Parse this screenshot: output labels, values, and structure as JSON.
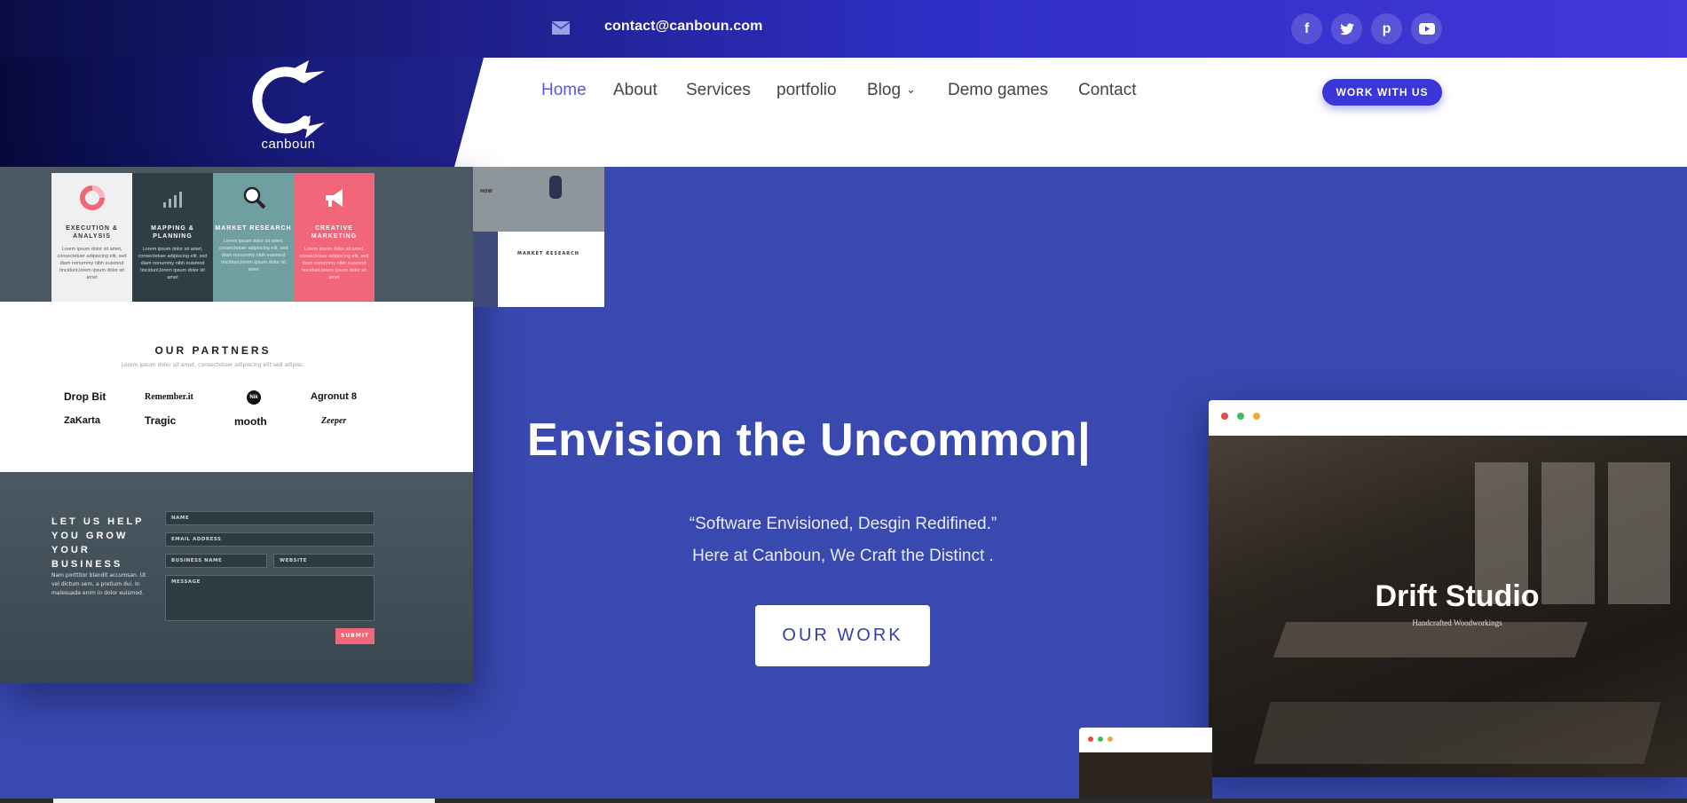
{
  "header": {
    "email": "contact@canboun.com",
    "logo_text": "canboun",
    "nav": [
      {
        "label": "Home",
        "active": true
      },
      {
        "label": "About"
      },
      {
        "label": "Services"
      },
      {
        "label": "portfolio"
      },
      {
        "label": "Blog",
        "has_dropdown": true
      },
      {
        "label": "Demo games"
      },
      {
        "label": "Contact"
      }
    ],
    "cta_label": "WORK WITH US",
    "social": [
      {
        "icon": "facebook-icon",
        "glyph": "f"
      },
      {
        "icon": "twitter-icon",
        "glyph": "t"
      },
      {
        "icon": "pinterest-icon",
        "glyph": "p"
      },
      {
        "icon": "youtube-icon",
        "glyph": "▶"
      }
    ]
  },
  "mockup_left": {
    "cards": [
      {
        "title": "EXECUTION & ANALYSIS",
        "body": "Lorem ipsum dolor sit amet, consectetuer adipiscing elit, sed diam nonummy nibh euismod tincidunt,lorem ipsum dolor sit amet",
        "icon": "pie-chart-icon"
      },
      {
        "title": "MAPPING & PLANNING",
        "body": "Lorem ipsum dolor sit amet, consectetuer adipiscing elit, sed diam nonummy nibh euismod tincidunt,lorem ipsum dolor sit amet",
        "icon": "bar-chart-icon"
      },
      {
        "title": "MARKET RESEARCH",
        "body": "Lorem ipsum dolor sit amet, consectetuer adipiscing elit, sed diam nonummy nibh euismod tincidunt,lorem ipsum dolor sit amet",
        "icon": "magnifier-icon"
      },
      {
        "title": "CREATIVE MARKETING",
        "body": "Lorem ipsum dolor sit amet, consectetuer adipiscing elit, sed diam nonummy nibh euismod tincidunt,lorem ipsum dolor sit amet",
        "icon": "megaphone-icon"
      }
    ],
    "partners_title": "OUR PARTNERS",
    "partners_sub": "Lorem ipsum dolor sit amet, consectetuer adipiscing elit sed adipisc.",
    "partners": [
      "Drop Bit",
      "Remember.it",
      "Nik",
      "Agronut 8",
      "ZaKarta",
      "Tragic",
      "mooth",
      "Zeeper"
    ],
    "form_title": "LET US HELP YOU GROW YOUR BUSINESS",
    "form_text": "Nam porttitor blandit accumsan. Ut vel dictum sem, a pretium dui. In malesuada enim in dolor euismod.",
    "fields": [
      "NAME",
      "EMAIL ADDRESS",
      "BUSINESS NAME",
      "WEBSITE",
      "MESSAGE"
    ],
    "submit_label": "SUBMIT",
    "small_mock_label": "MARKET RESEARCH",
    "small_mock_tag": "HOW"
  },
  "hero": {
    "title": "Envision the Uncommon|",
    "subtitle1": "“Software Envisioned, Desgin Redifined.”",
    "subtitle2": "Here at Canboun, We Craft the Distinct .",
    "button_label": "OUR WORK"
  },
  "mockup_right": {
    "title": "Drift Studio",
    "subtitle": "Handcrafted Woodworkings",
    "dot_colors": [
      "#e84b4b",
      "#3fbf5a",
      "#f2a93b"
    ]
  },
  "colors": {
    "accent": "#3a36d9",
    "hero_bg": "#3949b0",
    "nav_active": "#5b55e6"
  }
}
